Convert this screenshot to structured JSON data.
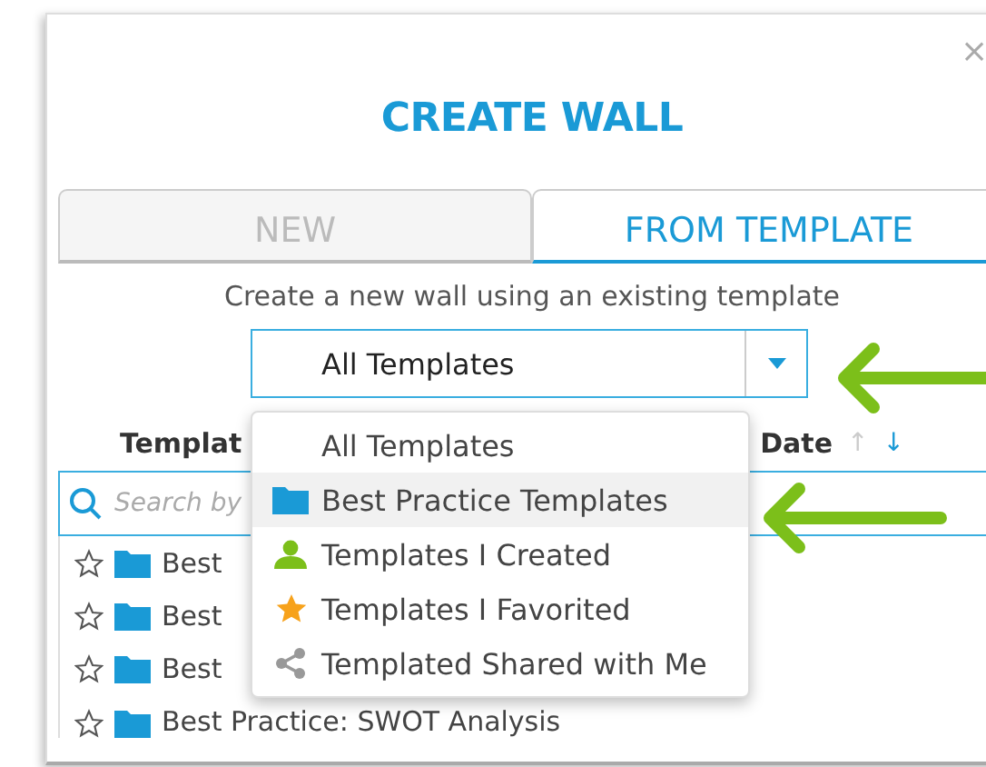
{
  "dialog": {
    "close": "×",
    "title": "CREATE WALL"
  },
  "tabs": [
    {
      "label": "NEW",
      "selected": false
    },
    {
      "label": "FROM TEMPLATE",
      "selected": true
    }
  ],
  "subtitle": "Create a new wall using an existing template",
  "filter": {
    "value": "All Templates",
    "expanded": true
  },
  "filter_options": [
    {
      "label": "All Templates",
      "kind": "none",
      "selected": false
    },
    {
      "label": "Best Practice Templates",
      "kind": "folder",
      "selected": true
    },
    {
      "label": "Templates I Created",
      "kind": "person",
      "selected": false
    },
    {
      "label": "Templates I Favorited",
      "kind": "star",
      "selected": false
    },
    {
      "label": "Templated Shared with Me",
      "kind": "share",
      "selected": false
    }
  ],
  "columns": {
    "name": "Templat",
    "date": "Date",
    "sort_arrows": [
      {
        "glyph": "↑",
        "selected": false
      },
      {
        "glyph": "↓",
        "selected": true
      }
    ]
  },
  "search": {
    "placeholder": "Search by"
  },
  "rows": [
    {
      "name": "Best",
      "favorite": false
    },
    {
      "name": "Best",
      "favorite": false
    },
    {
      "name": "Best",
      "favorite": false
    },
    {
      "name": "Best Practice: SWOT Analysis",
      "favorite": false
    }
  ]
}
